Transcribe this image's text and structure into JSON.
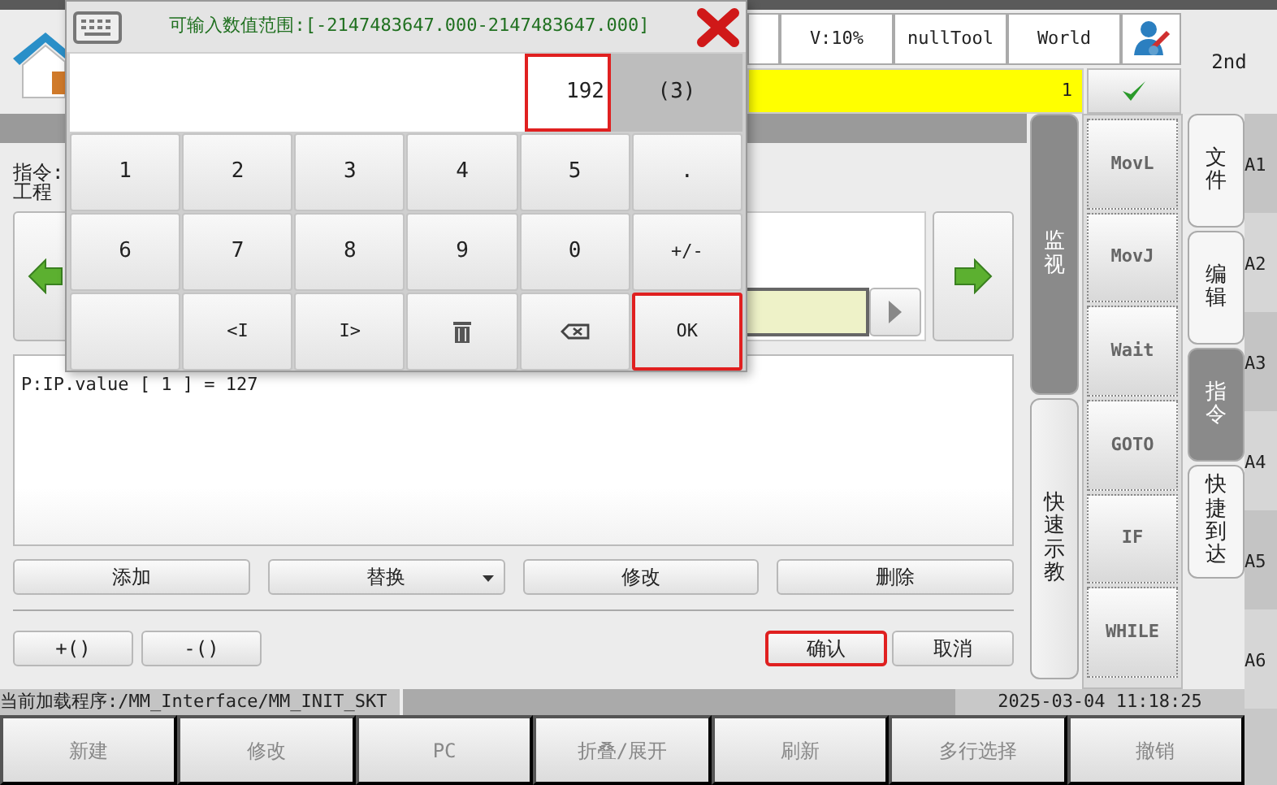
{
  "dialog": {
    "title": "可输入数值范围:[-2147483647.000-2147483647.000]",
    "value": "192",
    "value_highlighted": true,
    "length": "(3)",
    "keys": [
      {
        "kind": "text",
        "label": "1",
        "highlighted": false
      },
      {
        "kind": "text",
        "label": "2",
        "highlighted": false
      },
      {
        "kind": "text",
        "label": "3",
        "highlighted": false
      },
      {
        "kind": "text",
        "label": "4",
        "highlighted": false
      },
      {
        "kind": "text",
        "label": "5",
        "highlighted": false
      },
      {
        "kind": "text",
        "label": ".",
        "highlighted": false
      },
      {
        "kind": "text",
        "label": "6",
        "highlighted": false
      },
      {
        "kind": "text",
        "label": "7",
        "highlighted": false
      },
      {
        "kind": "text",
        "label": "8",
        "highlighted": false
      },
      {
        "kind": "text",
        "label": "9",
        "highlighted": false
      },
      {
        "kind": "text",
        "label": "0",
        "highlighted": false
      },
      {
        "kind": "text",
        "label": "+/-",
        "highlighted": false
      },
      {
        "kind": "blank",
        "highlighted": false
      },
      {
        "kind": "text",
        "label": "<I",
        "highlighted": false
      },
      {
        "kind": "text",
        "label": "I>",
        "highlighted": false
      },
      {
        "kind": "trash",
        "highlighted": false
      },
      {
        "kind": "backspace",
        "highlighted": false
      },
      {
        "kind": "text",
        "label": "OK",
        "highlighted": true
      }
    ]
  },
  "header": {
    "status": [
      "V:10%",
      "nullTool",
      "World"
    ],
    "counter": "1",
    "mode": "2nd"
  },
  "editor": {
    "labels": [
      "指令:",
      "工程"
    ],
    "code": "P:IP.value [ 1 ] = 127",
    "actions": [
      {
        "label": "添加",
        "dropdown": false
      },
      {
        "label": "替换",
        "dropdown": true
      },
      {
        "label": "修改",
        "dropdown": false
      },
      {
        "label": "删除",
        "dropdown": false
      }
    ],
    "left_buttons": [
      "+()",
      "-()"
    ],
    "confirm": [
      {
        "label": "确认",
        "highlighted": true
      },
      {
        "label": "取消",
        "highlighted": false
      }
    ]
  },
  "status_bar": {
    "program": "当前加载程序:/MM_Interface/MM_INIT_SKT",
    "datetime": "2025-03-04 11:18:25"
  },
  "bottom_buttons": [
    "新建",
    "修改",
    "PC",
    "折叠/展开",
    "刷新",
    "多行选择",
    "撤销"
  ],
  "view_tabs": [
    {
      "label": "监视",
      "selected": true
    },
    {
      "label": "快速示教",
      "selected": false
    }
  ],
  "instructions": [
    "MovL",
    "MovJ",
    "Wait",
    "GOTO",
    "IF",
    "WHILE"
  ],
  "menu_tabs": [
    {
      "label": "文件",
      "selected": false
    },
    {
      "label": "编辑",
      "selected": false
    },
    {
      "label": "指令",
      "selected": true
    },
    {
      "label": "快捷到达",
      "selected": false
    }
  ],
  "side_labels": [
    "A1",
    "A2",
    "A3",
    "A4",
    "A5",
    "A6"
  ]
}
